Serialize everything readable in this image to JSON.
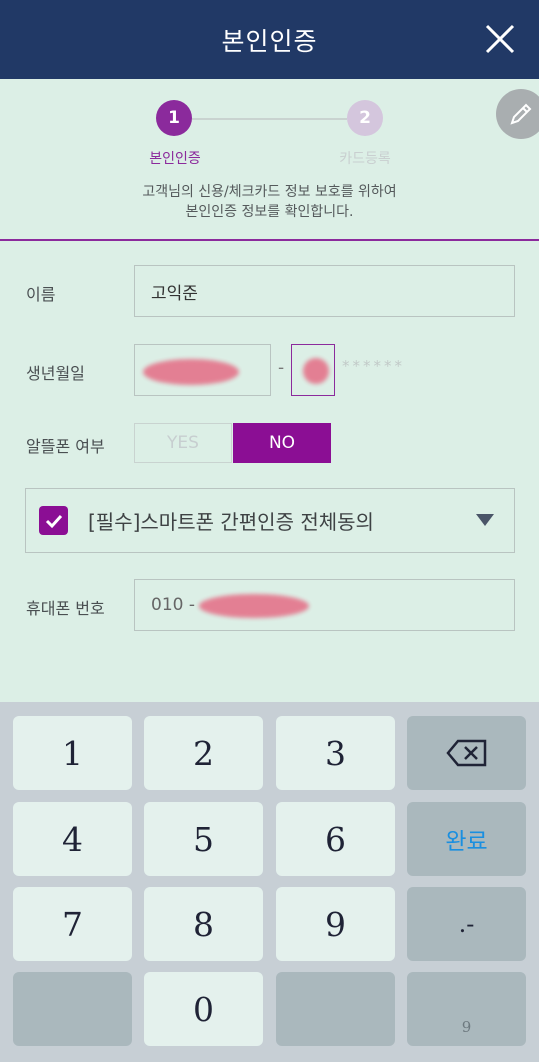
{
  "header": {
    "title": "본인인증"
  },
  "steps": [
    {
      "number": "1",
      "label": "본인인증"
    },
    {
      "number": "2",
      "label": "카드등록"
    }
  ],
  "notice": {
    "line1": "고객님의 신용/체크카드 정보 보호를 위하여",
    "line2": "본인인증 정보를 확인합니다."
  },
  "form": {
    "name": {
      "label": "이름",
      "value": "고익준"
    },
    "birth": {
      "label": "생년월일",
      "dash": "-",
      "masked": "******"
    },
    "mvno": {
      "label": "알뜰폰 여부",
      "yes": "YES",
      "no": "NO",
      "selected": "NO"
    },
    "agree": {
      "label": "[필수]스마트폰 간편인증 전체동의",
      "checked": true
    },
    "phone": {
      "label": "휴대폰 번호",
      "prefix": "010 -"
    }
  },
  "keyboard": {
    "keys": [
      "1",
      "2",
      "3",
      "4",
      "5",
      "6",
      "7",
      "8",
      "9",
      "0"
    ],
    "done": "완료",
    "dot_dash": ".-",
    "small": "9"
  },
  "colors": {
    "header": "#213966",
    "accent": "#8b0e94",
    "background": "#dcefe6",
    "done": "#1a8fe0"
  }
}
